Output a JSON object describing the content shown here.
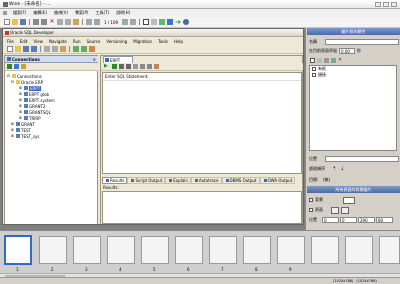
{
  "window": {
    "title": "Wink - [未命名] - ..."
  },
  "menubar": [
    "檔案(F)",
    "編輯(E)",
    "檢視(V)",
    "專案(P)",
    "工具(T)",
    "說明(H)"
  ],
  "toolbar": {
    "frame_counter": "1 / 109"
  },
  "sqldev": {
    "title": "Oracle SQL Developer",
    "menus": [
      "File",
      "Edit",
      "View",
      "Navigate",
      "Run",
      "Source",
      "Versioning",
      "Migration",
      "Tools",
      "Help"
    ],
    "connections_tab": "Connections",
    "tree": [
      {
        "label": "Connections",
        "level": 0
      },
      {
        "label": "Oracle ERP",
        "level": 1
      },
      {
        "label": "ERPT",
        "level": 2
      },
      {
        "label": "ERPT glob",
        "level": 2
      },
      {
        "label": "ERPT system",
        "level": 2
      },
      {
        "label": "GRANT2",
        "level": 2
      },
      {
        "label": "GRANTSQL",
        "level": 2
      },
      {
        "label": "TRIRP",
        "level": 2
      },
      {
        "label": "GRANT",
        "level": 1
      },
      {
        "label": "TEST",
        "level": 1
      },
      {
        "label": "TEST_sys",
        "level": 1
      }
    ],
    "editor_tab": "ERPT",
    "worksheet_header": "Enter SQL Statement:",
    "output_tabs": [
      "Results",
      "Script Output",
      "Explain",
      "Autotrace",
      "DBMS Output",
      "OWA Output"
    ],
    "results_label": "Results:"
  },
  "right_panel": {
    "title1": "圖片框的屬性",
    "name_label": "名稱",
    "delay_label": "在目前頁面停留",
    "delay_value": "0.00",
    "delay_unit": "秒",
    "list_items": [
      "有框",
      "鏈接"
    ],
    "position_label": "位置",
    "order_label": "處理順序",
    "target_label": "目標:",
    "target_value": "(無)",
    "title2": "所有頁面的背景圖片",
    "opt1": "背景",
    "opt2": "頁面",
    "position2_label": "位置",
    "coord_values": [
      "0",
      "0",
      "290",
      "80"
    ]
  },
  "filmstrip": {
    "numbers": [
      "1",
      "2",
      "3",
      "4",
      "5",
      "6",
      "7",
      "8",
      "9"
    ]
  },
  "statusbar": {
    "coords": "(1024x768)",
    "size": "(1024x768)"
  }
}
